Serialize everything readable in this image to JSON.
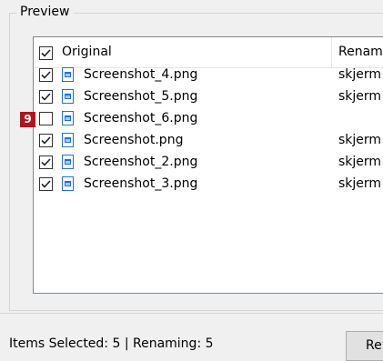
{
  "preview": {
    "group_title": "Preview",
    "columns": {
      "original": "Original",
      "renamed": "Renam"
    },
    "header_checked": true,
    "rows": [
      {
        "name": "Screenshot_4.png",
        "renamed": "skjerm",
        "checked": true
      },
      {
        "name": "Screenshot_5.png",
        "renamed": "skjerm",
        "checked": true
      },
      {
        "name": "Screenshot_6.png",
        "renamed": "",
        "checked": false
      },
      {
        "name": "Screenshot.png",
        "renamed": "skjerm",
        "checked": true
      },
      {
        "name": "Screenshot_2.png",
        "renamed": "skjerm",
        "checked": true
      },
      {
        "name": "Screenshot_3.png",
        "renamed": "skjerm",
        "checked": true
      }
    ],
    "badge": "9"
  },
  "status": {
    "text": "Items Selected: 5 | Renaming: 5"
  },
  "buttons": {
    "rename_label": "Re"
  },
  "icons": {
    "file": "image-file-icon",
    "check": "checkmark-icon"
  },
  "colors": {
    "badge": "#b0141d",
    "file_icon": "#1f6fd6"
  }
}
